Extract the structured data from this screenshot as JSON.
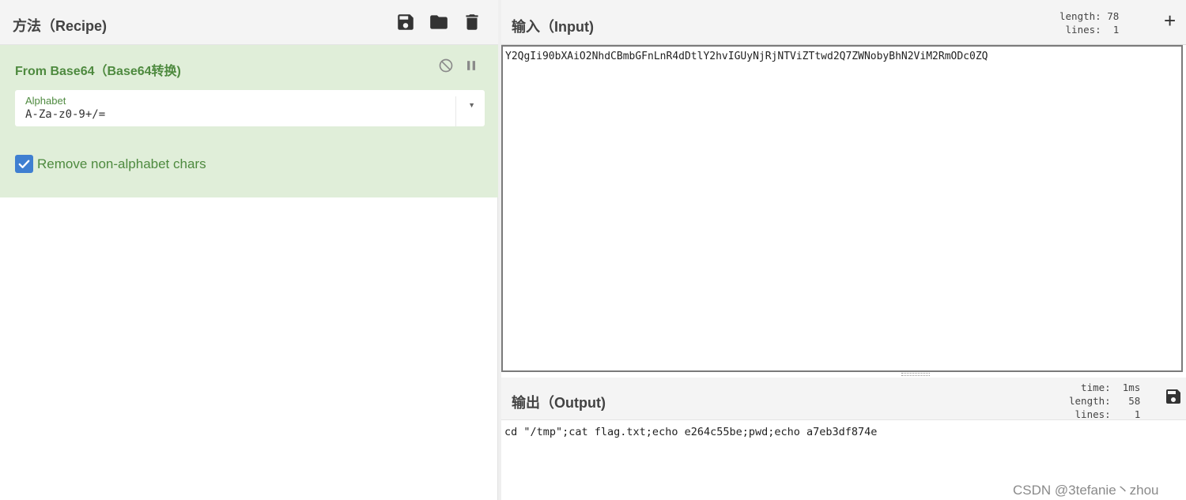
{
  "recipe": {
    "title": "方法（Recipe)",
    "icons": [
      "save-icon",
      "folder-icon",
      "trash-icon"
    ],
    "operation": {
      "title": "From Base64（Base64转换)",
      "icons": [
        "disable-icon",
        "pause-icon"
      ],
      "alphabet_label": "Alphabet",
      "alphabet_value": "A-Za-z0-9+/=",
      "remove_checked": true,
      "remove_label": "Remove non-alphabet chars"
    }
  },
  "input": {
    "title": "输入（Input)",
    "stats": "length: 78\n lines:  1",
    "add_label": "+",
    "text": "Y2QgIi90bXAiO2NhdCBmbGFnLnR4dDtlY2hvIGUyNjRjNTViZTtwd2Q7ZWNobyBhN2ViM2RmODc0ZQ"
  },
  "output": {
    "title": "输出（Output)",
    "stats": "  time:  1ms\nlength:   58\n lines:    1",
    "text": "cd \"/tmp\";cat flag.txt;echo e264c55be;pwd;echo a7eb3df874e"
  },
  "watermark": "CSDN @3tefanie丶zhou",
  "colors": {
    "op_background": "#e0eed9",
    "op_text": "#4e8a3f",
    "checkbox": "#3f7fd1"
  }
}
